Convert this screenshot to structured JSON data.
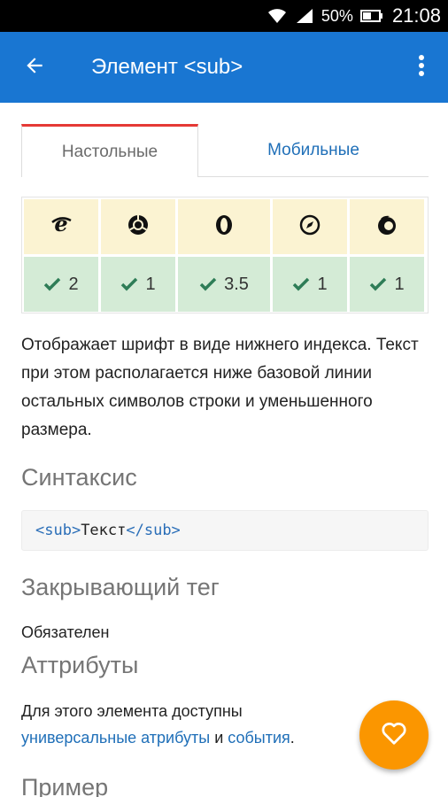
{
  "status_bar": {
    "battery_percent": "50%",
    "time": "21:08",
    "icons": [
      "wifi-icon",
      "signal-icon",
      "battery-icon"
    ]
  },
  "app_bar": {
    "title": "Элемент <sub>",
    "back_icon": "arrow-back-icon",
    "menu_icon": "more-vert-icon",
    "color": "#1976d2"
  },
  "tabs": [
    {
      "label": "Настольные",
      "active": true
    },
    {
      "label": "Мобильные",
      "active": false
    }
  ],
  "compat_table": {
    "browsers": [
      {
        "icon": "internet-explorer-icon",
        "version": "2"
      },
      {
        "icon": "chrome-icon",
        "version": "1"
      },
      {
        "icon": "opera-icon",
        "version": "3.5"
      },
      {
        "icon": "safari-icon",
        "version": "1"
      },
      {
        "icon": "firefox-icon",
        "version": "1"
      }
    ],
    "check_icon": "check-icon"
  },
  "description": "Отображает шрифт в виде нижнего индекса. Текст при этом располагается ниже базовой линии остальных символов строки и уменьшенного размера.",
  "syntax": {
    "heading": "Синтаксис",
    "open_tag": "<sub>",
    "text": "Текст",
    "close_tag": "</sub>"
  },
  "closing_tag": {
    "heading": "Закрывающий тег",
    "value": "Обязателен"
  },
  "attributes": {
    "heading": "Аттрибуты",
    "text_before": "Для этого элемента доступны",
    "link1": "универсальные атрибуты",
    "joiner": " и ",
    "link2": "события",
    "end": "."
  },
  "example": {
    "heading": "Пример"
  },
  "fab": {
    "icon": "heart-icon",
    "color": "#fb9600"
  }
}
